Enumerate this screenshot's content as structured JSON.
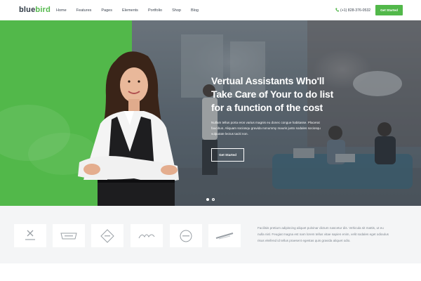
{
  "header": {
    "logo_part1": "blue",
    "logo_part2": "bird",
    "nav": [
      "Home",
      "Features",
      "Pages",
      "Elements",
      "Portfolio",
      "Shop",
      "Blog"
    ],
    "phone_icon": "phone-icon",
    "phone": "(+1) 828-376-0532",
    "cta": "Get Started"
  },
  "hero": {
    "title": "Vertual Assistants Who'll Take Care of Your to do list for a function of the cost",
    "body": "Nullam tellus porta eros varius magnis eu donec congue habitasse. Placerat faucibus. Aliquam sociosqu gravida nonummy mauris justo sodales sociosqu vulputate lectus taciti non.",
    "button": "Get Started",
    "slides": 2,
    "active_slide": 1
  },
  "brands": {
    "logos": [
      "brand-logo-1",
      "brand-logo-2",
      "brand-logo-3",
      "brand-logo-4",
      "brand-logo-5",
      "brand-logo-6"
    ],
    "about": "Facilisis pretium adipiscing aliquet pulvinar dictum nascetur dis. Vehicula sit mattis, ut eu nulla nisl. Feugiat magna est nam lorem tellus vitae sapien enim, velit sodales eget odioulus risus eleifend id tellus praesent egestas quis gravida aliquet odio."
  },
  "colors": {
    "accent": "#52b84a",
    "text": "#3b4450"
  }
}
